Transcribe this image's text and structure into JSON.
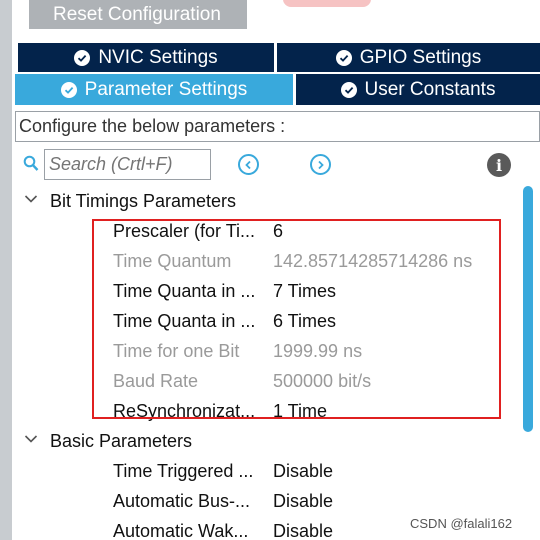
{
  "toolbar": {
    "reset_label": "Reset Configuration"
  },
  "tabs": [
    {
      "label": "NVIC Settings",
      "active": false
    },
    {
      "label": "GPIO Settings",
      "active": false
    },
    {
      "label": "Parameter Settings",
      "active": true
    },
    {
      "label": "User Constants",
      "active": false
    }
  ],
  "configure_text": "Configure the below parameters :",
  "search": {
    "placeholder": "Search (Crtl+F)"
  },
  "sections": [
    {
      "title": "Bit Timings Parameters",
      "rows": [
        {
          "name": "Prescaler (for Ti...",
          "value": "6",
          "editable": true
        },
        {
          "name": "Time Quantum",
          "value": "142.85714285714286 ns",
          "editable": false
        },
        {
          "name": "Time Quanta in ...",
          "value": "7 Times",
          "editable": true
        },
        {
          "name": "Time Quanta in ...",
          "value": "6 Times",
          "editable": true
        },
        {
          "name": "Time for one Bit",
          "value": "1999.99 ns",
          "editable": false
        },
        {
          "name": "Baud Rate",
          "value": "500000 bit/s",
          "editable": false
        },
        {
          "name": "ReSynchronizat...",
          "value": "1 Time",
          "editable": true
        }
      ]
    },
    {
      "title": "Basic Parameters",
      "rows": [
        {
          "name": "Time Triggered ...",
          "value": "Disable",
          "editable": true
        },
        {
          "name": "Automatic Bus-...",
          "value": "Disable",
          "editable": true
        },
        {
          "name": "Automatic Wak...",
          "value": "Disable",
          "editable": true
        }
      ]
    }
  ],
  "watermark": "CSDN @falali162",
  "colors": {
    "tab_dark": "#03234b",
    "tab_active": "#39a9dc",
    "highlight": "#e02020"
  }
}
